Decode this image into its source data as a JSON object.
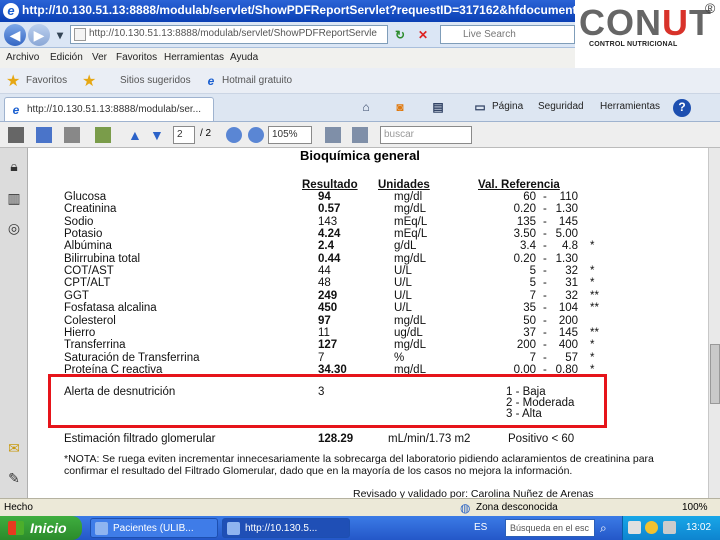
{
  "window": {
    "title": "http://10.130.51.13:8888/modulab/servlet/ShowPDFReportServlet?requestID=317162&hfdocumentformat"
  },
  "addressbar": {
    "url": "http://10.130.51.13:8888/modulab/servlet/ShowPDFReportServle",
    "search_placeholder": "Live Search"
  },
  "logo": {
    "text_a": "CON",
    "text_u": "U",
    "text_b": "T",
    "registered": "®",
    "subtitle": "CONTROL NUTRICIONAL"
  },
  "menu": [
    "Archivo",
    "Edición",
    "Ver",
    "Favoritos",
    "Herramientas",
    "Ayuda"
  ],
  "favorites": {
    "label": "Favoritos",
    "items": [
      "Sitios sugeridos",
      "Hotmail gratuito"
    ]
  },
  "tab": {
    "label": "http://10.130.51.13:8888/modulab/ser..."
  },
  "commandbar": {
    "page": "Página",
    "security": "Seguridad",
    "tools": "Herramientas"
  },
  "pdf_toolbar": {
    "page_current": "2",
    "page_total": "/ 2",
    "zoom": "105%",
    "search_placeholder": "buscar"
  },
  "report": {
    "section_title": "Bioquímica general",
    "headers": {
      "result": "Resultado",
      "units": "Unidades",
      "ref": "Val. Referencia"
    },
    "rows": [
      {
        "name": "Glucosa",
        "result": "94",
        "bold": true,
        "unit": "mg/dl",
        "low": "60",
        "high": "110",
        "flag": ""
      },
      {
        "name": "Creatinina",
        "result": "0.57",
        "bold": true,
        "unit": "mg/dL",
        "low": "0.20",
        "high": "1.30",
        "flag": ""
      },
      {
        "name": "Sodio",
        "result": "143",
        "bold": false,
        "unit": "mEq/L",
        "low": "135",
        "high": "145",
        "flag": ""
      },
      {
        "name": "Potasio",
        "result": "4.24",
        "bold": true,
        "unit": "mEq/L",
        "low": "3.50",
        "high": "5.00",
        "flag": ""
      },
      {
        "name": "Albúmina",
        "result": "2.4",
        "bold": true,
        "unit": "g/dL",
        "low": "3.4",
        "high": "4.8",
        "flag": "*"
      },
      {
        "name": "Bilirrubina total",
        "result": "0.44",
        "bold": true,
        "unit": "mg/dL",
        "low": "0.20",
        "high": "1.30",
        "flag": ""
      },
      {
        "name": "COT/AST",
        "result": "44",
        "bold": false,
        "unit": "U/L",
        "low": "5",
        "high": "32",
        "flag": "*"
      },
      {
        "name": "CPT/ALT",
        "result": "48",
        "bold": false,
        "unit": "U/L",
        "low": "5",
        "high": "31",
        "flag": "*"
      },
      {
        "name": "GGT",
        "result": "249",
        "bold": true,
        "unit": "U/L",
        "low": "7",
        "high": "32",
        "flag": "**"
      },
      {
        "name": "Fosfatasa alcalina",
        "result": "450",
        "bold": true,
        "unit": "U/L",
        "low": "35",
        "high": "104",
        "flag": "**"
      },
      {
        "name": "Colesterol",
        "result": "97",
        "bold": true,
        "unit": "mg/dL",
        "low": "50",
        "high": "200",
        "flag": ""
      },
      {
        "name": "Hierro",
        "result": "11",
        "bold": false,
        "unit": "ug/dL",
        "low": "37",
        "high": "145",
        "flag": "**"
      },
      {
        "name": "Transferrina",
        "result": "127",
        "bold": true,
        "unit": "mg/dL",
        "low": "200",
        "high": "400",
        "flag": "*"
      },
      {
        "name": "Saturación de Transferrina",
        "result": "7",
        "bold": false,
        "unit": "%",
        "low": "7",
        "high": "57",
        "flag": "*"
      },
      {
        "name": "Proteína C reactiva",
        "result": "34.30",
        "bold": true,
        "unit": "mg/dL",
        "low": "0.00",
        "high": "0.80",
        "flag": "*"
      }
    ],
    "alert": {
      "name": "Alerta de desnutrición",
      "result": "3",
      "levels": [
        "1 - Baja",
        "2 - Moderada",
        "3 - Alta"
      ]
    },
    "gfr": {
      "name": "Estimación filtrado glomerular",
      "result": "128.29",
      "unit": "mL/min/1.73 m2",
      "ref": "Positivo  < 60"
    },
    "note_line1": "*NOTA: Se ruega eviten incrementar innecesariamente la sobrecarga del laboratorio pidiendo aclaramientos de creatinina para",
    "note_line2": "confirmar el resultado del Filtrado Glomerular, dado que en la mayoría de los casos no mejora la información.",
    "signature": "Revisado y validado por:   Carolina Nuñez de Arenas"
  },
  "statusbar": {
    "left": "Hecho",
    "zone": "Zona desconocida",
    "zoom": "100%"
  },
  "taskbar": {
    "start": "Inicio",
    "tasks": [
      "Pacientes (ULIB...",
      "http://10.130.5..."
    ],
    "lang": "ES",
    "search": "Búsqueda en el esc",
    "time": "13:02"
  }
}
